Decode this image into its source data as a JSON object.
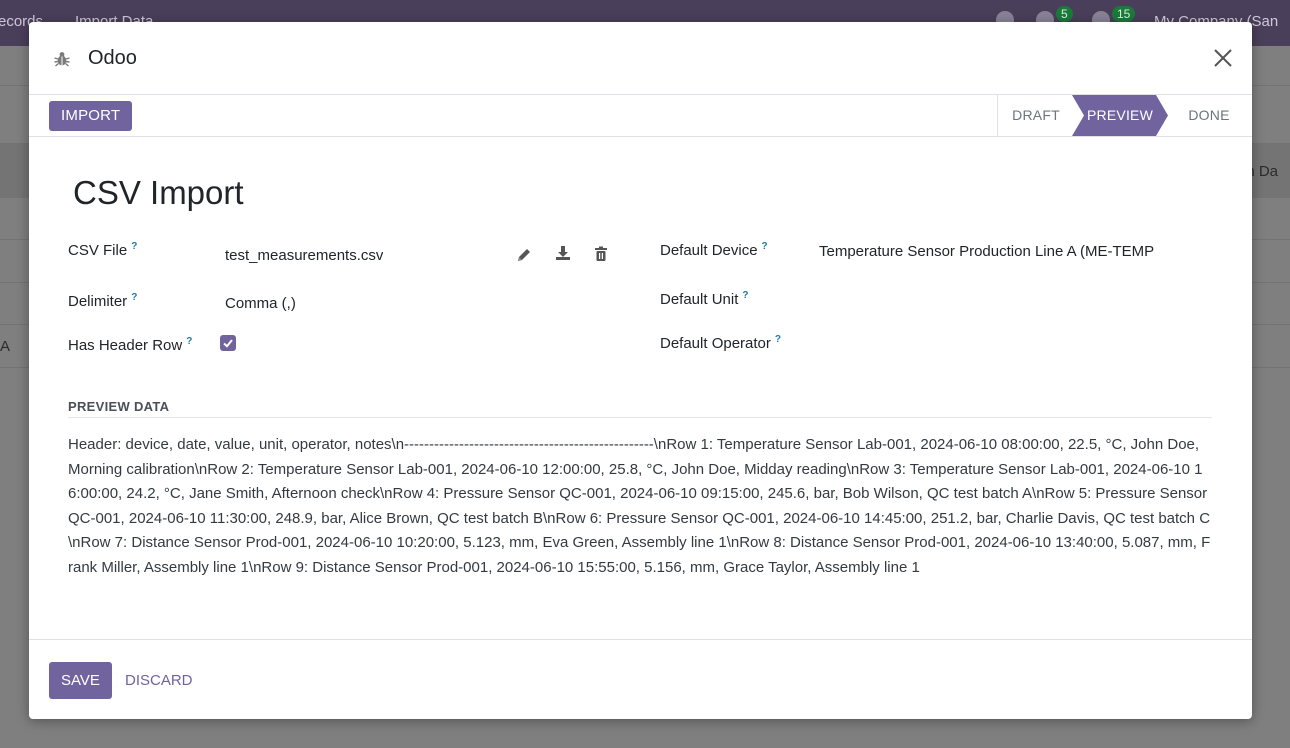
{
  "background": {
    "breadcrumb_prev": "ecords",
    "breadcrumb_current": "Import Data",
    "messages_count": "5",
    "activities_count": "15",
    "company": "My Company (San",
    "column_fragment": "on Da",
    "row_fragment": "A"
  },
  "modal": {
    "title": "Odoo",
    "title_icon": "bug-icon",
    "close_icon": "close-icon"
  },
  "statusbar": {
    "import_label": "IMPORT",
    "stages": [
      "DRAFT",
      "PREVIEW",
      "DONE"
    ],
    "active_stage": "PREVIEW"
  },
  "form": {
    "title": "CSV Import",
    "csv_file_label": "CSV File",
    "csv_file_value": "test_measurements.csv",
    "delimiter_label": "Delimiter",
    "delimiter_value": "Comma (,)",
    "has_header_label": "Has Header Row",
    "has_header_checked": true,
    "default_device_label": "Default Device",
    "default_device_value": "Temperature Sensor Production Line A (ME-TEMP",
    "default_unit_label": "Default Unit",
    "default_operator_label": "Default Operator",
    "help_mark": "?"
  },
  "preview": {
    "section_title": "PREVIEW DATA",
    "text": "Header: device, date, value, unit, operator, notes\\n--------------------------------------------------\\nRow 1: Temperature Sensor Lab-001, 2024-06-10 08:00:00, 22.5, °C, John Doe, Morning calibration\\nRow 2: Temperature Sensor Lab-001, 2024-06-10 12:00:00, 25.8, °C, John Doe, Midday reading\\nRow 3: Temperature Sensor Lab-001, 2024-06-10 16:00:00, 24.2, °C, Jane Smith, Afternoon check\\nRow 4: Pressure Sensor QC-001, 2024-06-10 09:15:00, 245.6, bar, Bob Wilson, QC test batch A\\nRow 5: Pressure Sensor QC-001, 2024-06-10 11:30:00, 248.9, bar, Alice Brown, QC test batch B\\nRow 6: Pressure Sensor QC-001, 2024-06-10 14:45:00, 251.2, bar, Charlie Davis, QC test batch C\\nRow 7: Distance Sensor Prod-001, 2024-06-10 10:20:00, 5.123, mm, Eva Green, Assembly line 1\\nRow 8: Distance Sensor Prod-001, 2024-06-10 13:40:00, 5.087, mm, Frank Miller, Assembly line 1\\nRow 9: Distance Sensor Prod-001, 2024-06-10 15:55:00, 5.156, mm, Grace Taylor, Assembly line 1"
  },
  "footer": {
    "save_label": "SAVE",
    "discard_label": "DISCARD"
  },
  "colors": {
    "primary": "#71639e",
    "help": "#1f7aa5"
  }
}
